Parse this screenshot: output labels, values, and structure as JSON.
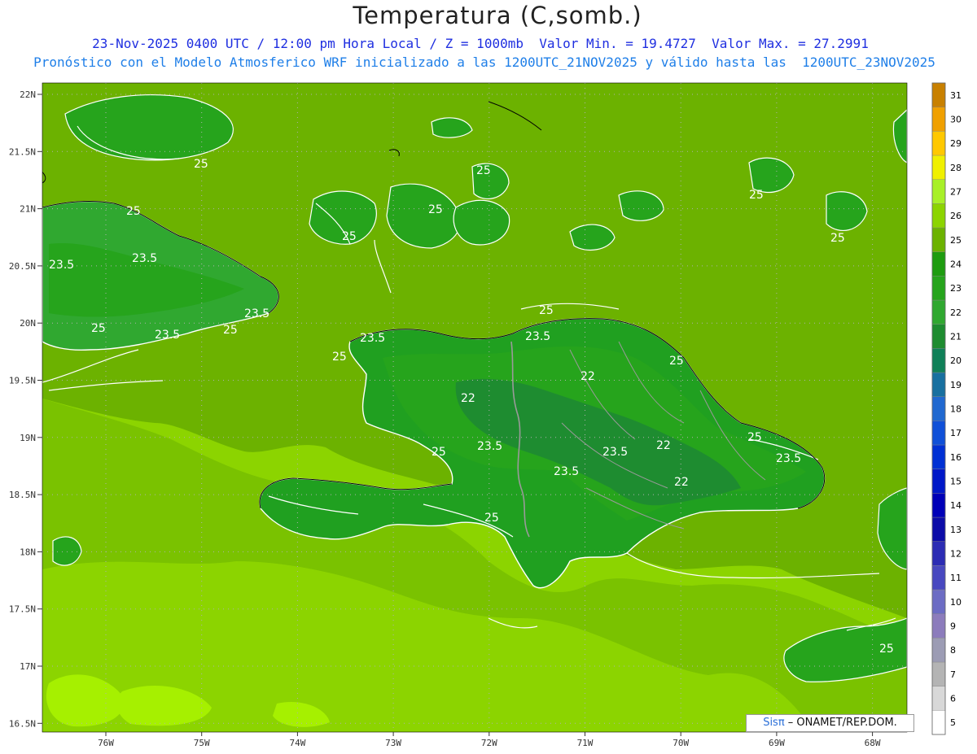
{
  "header": {
    "title": "Temperatura (C,somb.)",
    "subtitle1": "23-Nov-2025 0400 UTC / 12:00 pm Hora Local / Z = 1000mb  Valor Min. = 19.4727  Valor Max. = 27.2991",
    "subtitle2": "Pronóstico con el Modelo Atmosferico WRF inicializado a las 1200UTC_21NOV2025 y válido hasta las  1200UTC_23NOV2025"
  },
  "colors": {
    "lowland": "#8cd400",
    "warm_patch": "#a6f000",
    "coast_band": "#6fb400",
    "sea": "#6cb200",
    "temp24": "#20a020",
    "temp23": "#30a830",
    "temp22": "#1e8c30",
    "contour": "#ffffff",
    "coastline": "#000000",
    "border": "#9a9a9a"
  },
  "axes": {
    "lat_labels": [
      "22N",
      "21.5N",
      "21N",
      "20.5N",
      "20N",
      "19.5N",
      "19N",
      "18.5N",
      "18N",
      "17.5N",
      "17N",
      "16.5N"
    ],
    "lon_labels": [
      "76W",
      "75W",
      "74W",
      "73W",
      "72W",
      "71W",
      "70W",
      "69W",
      "68W"
    ]
  },
  "colorbar": {
    "labels": [
      "5",
      "6",
      "7",
      "8",
      "9",
      "10",
      "11",
      "12",
      "13",
      "14",
      "15",
      "16",
      "17",
      "18",
      "19",
      "20",
      "21",
      "22",
      "23",
      "24",
      "25",
      "26",
      "27",
      "28",
      "29",
      "30",
      "31"
    ],
    "colors": [
      "#ffffff",
      "#d8d8d8",
      "#b4b4b4",
      "#9c9cb4",
      "#8c7cbc",
      "#6c6cc4",
      "#4848c0",
      "#2c2cb4",
      "#0c0ca8",
      "#0000b8",
      "#0018c8",
      "#0030d4",
      "#1050d8",
      "#2068d0",
      "#1870a0",
      "#108058",
      "#1e8c30",
      "#30a830",
      "#26a41c",
      "#1e9c10",
      "#6cb200",
      "#8cd400",
      "#a8f028",
      "#f0f000",
      "#ffc800",
      "#f0a000",
      "#c88000"
    ]
  },
  "contour_labels": [
    "25",
    "25",
    "25",
    "25",
    "25",
    "25",
    "25",
    "25",
    "25",
    "25",
    "25",
    "25",
    "25",
    "25",
    "25",
    "25",
    "23.5",
    "23.5",
    "23.5",
    "23.5",
    "23.5",
    "23.5",
    "23.5",
    "23.5",
    "23.5",
    "23.5",
    "22",
    "22",
    "22",
    "22"
  ],
  "credit": {
    "brand": "Sisπ",
    "text": " – ONAMET/REP.DOM."
  }
}
